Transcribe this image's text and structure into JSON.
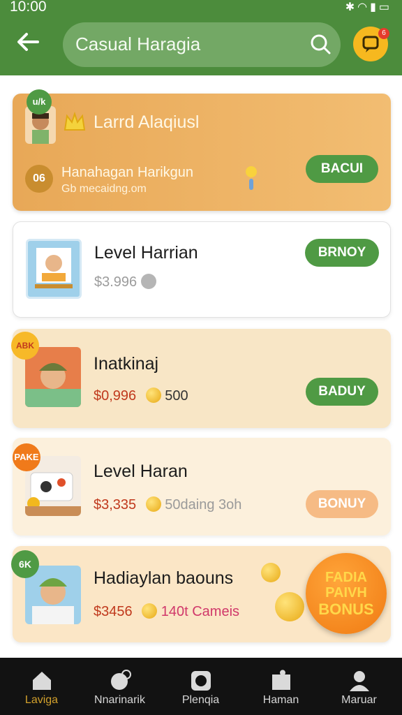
{
  "status_bar": {
    "time": "10:00",
    "icons": [
      "bluetooth-icon",
      "wifi-icon",
      "signal-icon",
      "battery-icon"
    ]
  },
  "header": {
    "back_icon": "back-arrow-icon",
    "search": {
      "value": "Casual Haragia",
      "icon": "search-icon"
    },
    "notification": {
      "icon": "notification-icon",
      "badge": "6"
    },
    "background_color": "#4c8c3c"
  },
  "cards": [
    {
      "badge": "u/k",
      "title": "Larrd Alaqiusl",
      "level_badge": "06",
      "subtitle": "Hanahagan Harikgun",
      "caption": "Gb mecaidng.om",
      "button": "BACUI",
      "background_color": "#f0b86a"
    },
    {
      "title": "Level Harrian",
      "price": "$3.996",
      "button": "BRNOY",
      "background_color": "#ffffff"
    },
    {
      "badge": "ABK",
      "title": "Inatkinaj",
      "price": "$0,996",
      "reward": "500",
      "button": "BADUY",
      "background_color": "#f8e6c6"
    },
    {
      "badge": "PAKE",
      "title": "Level Haran",
      "price": "$3,335",
      "reward": "50daing 3oh",
      "button": "BONUY",
      "background_color": "#fcf0dc"
    },
    {
      "badge": "6K",
      "title": "Hadiaylan baouns",
      "price": "$3456",
      "reward": "140t Cameis",
      "bonus_seal": [
        "FADIA",
        "PAIVH",
        "BONUS"
      ],
      "background_color": "#fbe6c6"
    }
  ],
  "bottom_nav": {
    "items": [
      {
        "label": "Laviga",
        "icon": "home-icon",
        "active": true
      },
      {
        "label": "Nnarinarik",
        "icon": "chart-icon",
        "active": false
      },
      {
        "label": "Plenqia",
        "icon": "camera-icon",
        "active": false
      },
      {
        "label": "Haman",
        "icon": "puzzle-icon",
        "active": false
      },
      {
        "label": "Maruar",
        "icon": "profile-icon",
        "active": false
      }
    ],
    "active_color": "#d2a02c"
  }
}
